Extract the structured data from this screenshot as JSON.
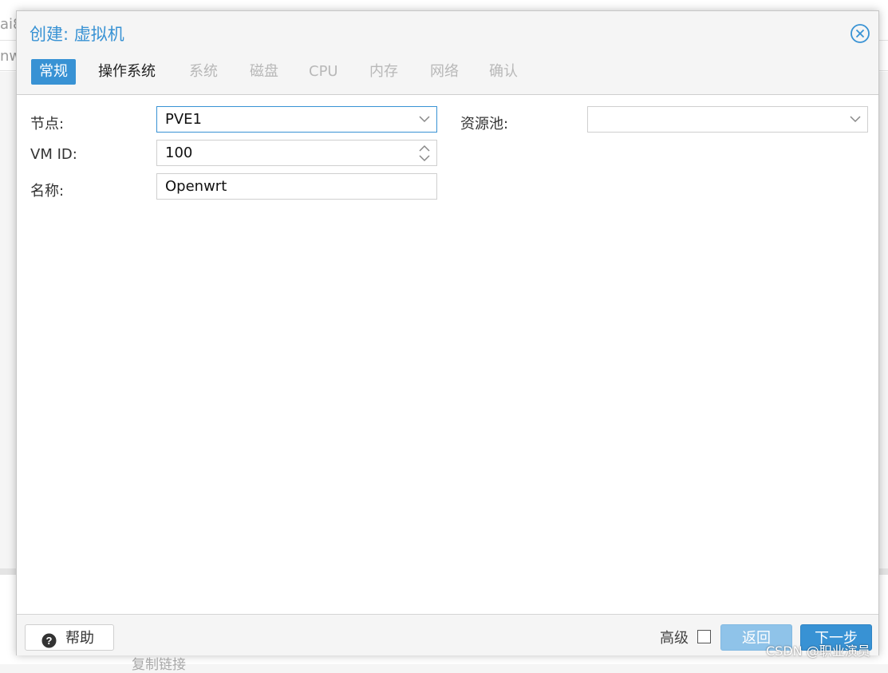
{
  "background": {
    "fragments": [
      "ai8",
      "nw"
    ],
    "bottom_text": "复制链接"
  },
  "dialog": {
    "title": "创建: 虚拟机",
    "tabs": [
      {
        "label": "常规",
        "state": "active"
      },
      {
        "label": "操作系统",
        "state": "enabled"
      },
      {
        "label": "系统",
        "state": "disabled"
      },
      {
        "label": "磁盘",
        "state": "disabled"
      },
      {
        "label": "CPU",
        "state": "disabled"
      },
      {
        "label": "内存",
        "state": "disabled"
      },
      {
        "label": "网络",
        "state": "disabled"
      },
      {
        "label": "确认",
        "state": "disabled"
      }
    ],
    "form": {
      "node_label": "节点:",
      "node_value": "PVE1",
      "vmid_label": "VM ID:",
      "vmid_value": "100",
      "name_label": "名称:",
      "name_value": "Openwrt",
      "pool_label": "资源池:",
      "pool_value": ""
    },
    "footer": {
      "help_label": "帮助",
      "advanced_label": "高级",
      "advanced_checked": false,
      "back_label": "返回",
      "next_label": "下一步"
    }
  },
  "colors": {
    "accent": "#3892d4",
    "accent_disabled": "#8fc3e9",
    "disabled_text": "#b8b8b8"
  },
  "watermark": "CSDN @职业演员"
}
